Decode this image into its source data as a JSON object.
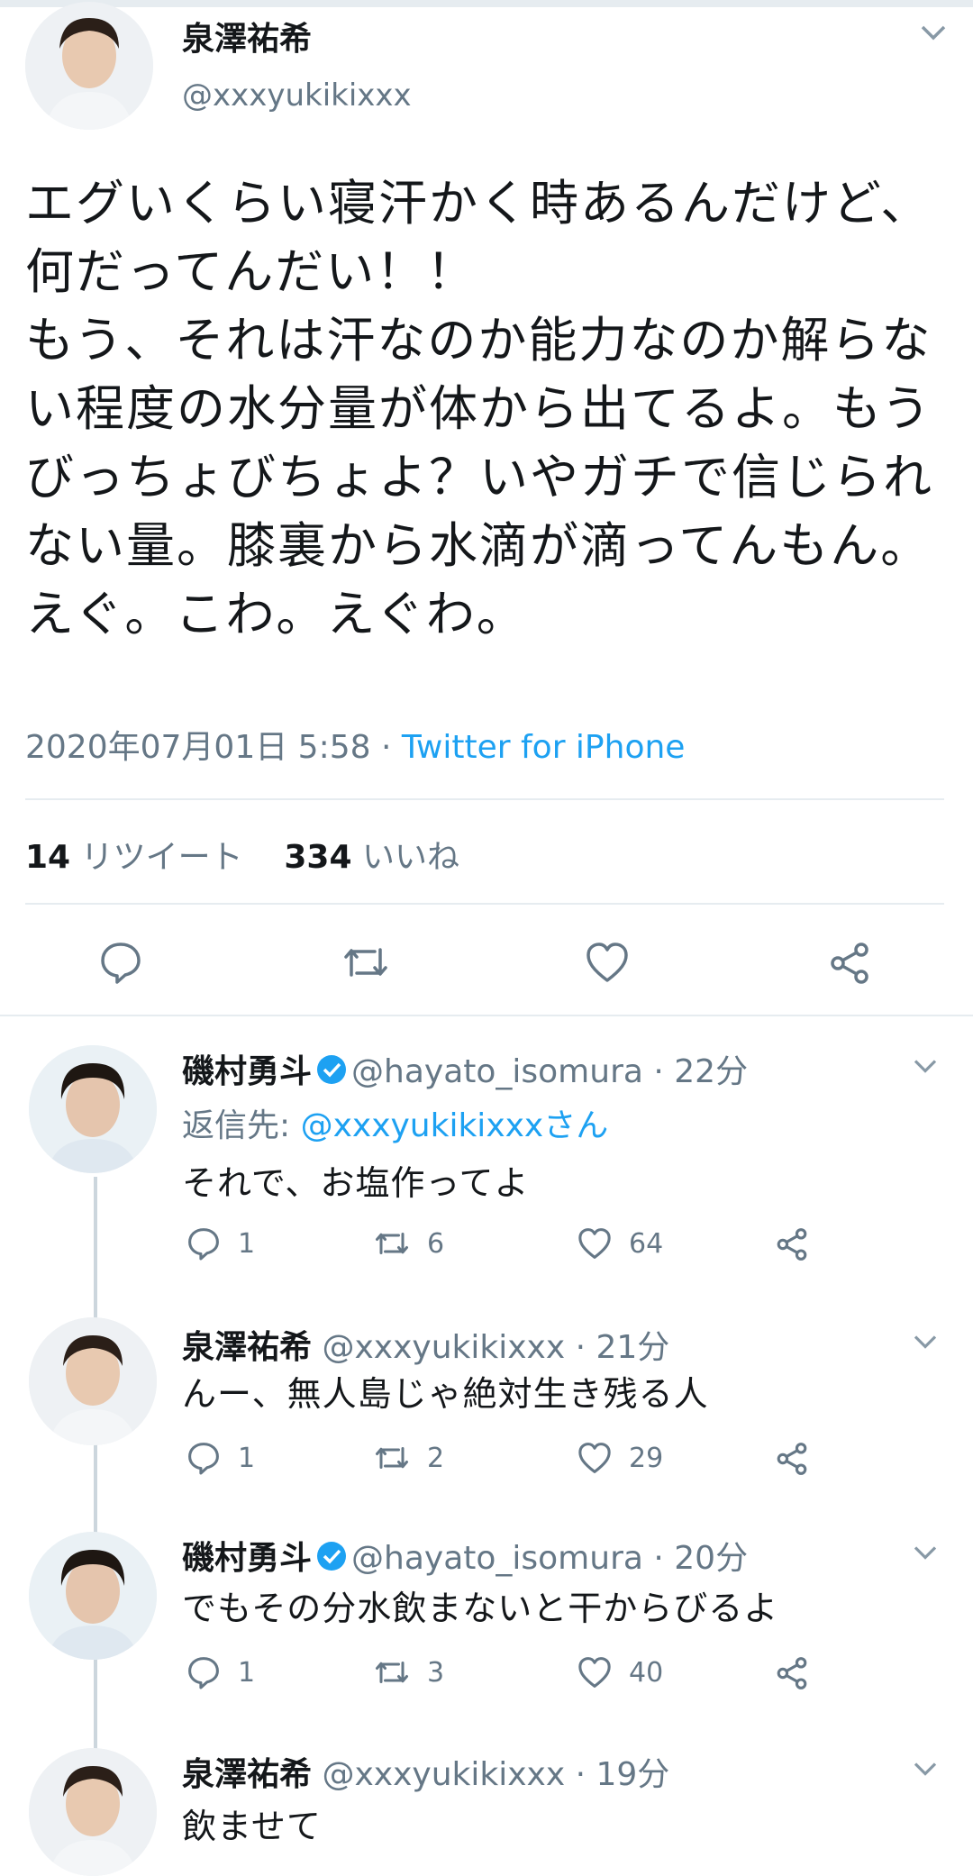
{
  "main_tweet": {
    "name": "泉澤祐希",
    "handle": "@xxxyukikixxx",
    "text": "エグいくらい寝汗かく時あるんだけど、何だってんだい！！\nもう、それは汗なのか能力なのか解らない程度の水分量が体から出てるよ。もうびっちょびちょよ？いやガチで信じられない量。膝裏から水滴が滴ってんもん。えぐ。こわ。えぐわ。",
    "timestamp": "2020年07月01日 5:58",
    "separator": "·",
    "via": "Twitter for iPhone",
    "retweets_count": "14",
    "retweets_label": "リツイート",
    "likes_count": "334",
    "likes_label": "いいね"
  },
  "replies": [
    {
      "name": "磯村勇斗",
      "handle": "@hayato_isomura",
      "time": "· 22分",
      "reply_prefix": "返信先: ",
      "reply_to": "@xxxyukikixxxさん",
      "text": "それで、お塩作ってよ",
      "replies": "1",
      "retweets": "6",
      "likes": "64"
    },
    {
      "name": "泉澤祐希",
      "handle": "@xxxyukikixxx",
      "time": "· 21分",
      "text": "んー、無人島じゃ絶対生き残る人",
      "replies": "1",
      "retweets": "2",
      "likes": "29"
    },
    {
      "name": "磯村勇斗",
      "handle": "@hayato_isomura",
      "time": "· 20分",
      "text": "でもその分水飲まないと干からびるよ",
      "replies": "1",
      "retweets": "3",
      "likes": "40"
    },
    {
      "name": "泉澤祐希",
      "handle": "@xxxyukikixxx",
      "time": "· 19分",
      "text": "飲ませて"
    }
  ],
  "colors": {
    "link": "#1da1f2",
    "muted": "#657786",
    "verified": "#1da1f2"
  }
}
